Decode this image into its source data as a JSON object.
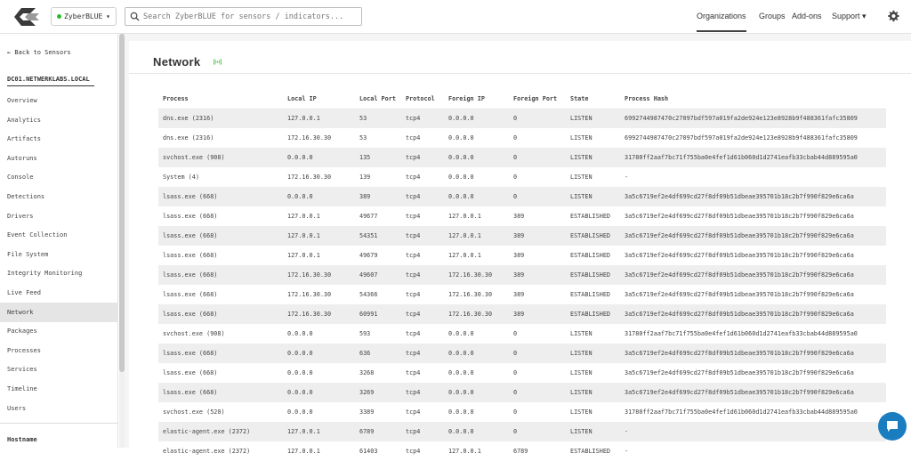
{
  "header": {
    "org": "ZyberBLUE",
    "search_placeholder": "Search ZyberBLUE for sensors / indicators...",
    "nav": [
      "Organizations",
      "Groups",
      "Add-ons",
      "Support"
    ]
  },
  "sidebar": {
    "back": "← Back to Sensors",
    "hostname": "DC01.NETWERKLABS.LOCAL",
    "items": [
      "Overview",
      "Analytics",
      "Artifacts",
      "Autoruns",
      "Console",
      "Detections",
      "Drivers",
      "Event Collection",
      "File System",
      "Integrity Monitoring",
      "Live Feed",
      "Network",
      "Packages",
      "Processes",
      "Services",
      "Timeline",
      "Users"
    ],
    "active": "Network",
    "footer_label": "Hostname"
  },
  "page": {
    "title": "Network"
  },
  "table": {
    "columns": [
      "Process",
      "Local IP",
      "Local Port",
      "Protocol",
      "Foreign IP",
      "Foreign Port",
      "State",
      "Process Hash"
    ],
    "rows": [
      [
        "dns.exe (2316)",
        "127.0.0.1",
        "53",
        "tcp4",
        "0.0.0.0",
        "0",
        "LISTEN",
        "6992744987470c27097bdf597a019fa2de924e123e8928b9f488361fafc35809"
      ],
      [
        "dns.exe (2316)",
        "172.16.30.30",
        "53",
        "tcp4",
        "0.0.0.0",
        "0",
        "LISTEN",
        "6992744987470c27097bdf597a019fa2de924e123e8928b9f488361fafc35809"
      ],
      [
        "svchost.exe (908)",
        "0.0.0.0",
        "135",
        "tcp4",
        "0.0.0.0",
        "0",
        "LISTEN",
        "31780ff2aaf7bc71f755ba0e4fef1d61b060d1d2741eafb33cbab44d889595a0"
      ],
      [
        "System (4)",
        "172.16.30.30",
        "139",
        "tcp4",
        "0.0.0.0",
        "0",
        "LISTEN",
        "-"
      ],
      [
        "lsass.exe (668)",
        "0.0.0.0",
        "389",
        "tcp4",
        "0.0.0.0",
        "0",
        "LISTEN",
        "3a5c6719ef2e4df699cd27f8df09b51dbeae395701b18c2b7f990f829e6ca6a"
      ],
      [
        "lsass.exe (668)",
        "127.0.0.1",
        "49677",
        "tcp4",
        "127.0.0.1",
        "389",
        "ESTABLISHED",
        "3a5c6719ef2e4df699cd27f8df09b51dbeae395701b18c2b7f990f829e6ca6a"
      ],
      [
        "lsass.exe (668)",
        "127.0.0.1",
        "54351",
        "tcp4",
        "127.0.0.1",
        "389",
        "ESTABLISHED",
        "3a5c6719ef2e4df699cd27f8df09b51dbeae395701b18c2b7f990f829e6ca6a"
      ],
      [
        "lsass.exe (668)",
        "127.0.0.1",
        "49679",
        "tcp4",
        "127.0.0.1",
        "389",
        "ESTABLISHED",
        "3a5c6719ef2e4df699cd27f8df09b51dbeae395701b18c2b7f990f829e6ca6a"
      ],
      [
        "lsass.exe (668)",
        "172.16.30.30",
        "49607",
        "tcp4",
        "172.16.30.30",
        "389",
        "ESTABLISHED",
        "3a5c6719ef2e4df699cd27f8df09b51dbeae395701b18c2b7f990f829e6ca6a"
      ],
      [
        "lsass.exe (668)",
        "172.16.30.30",
        "54366",
        "tcp4",
        "172.16.30.30",
        "389",
        "ESTABLISHED",
        "3a5c6719ef2e4df699cd27f8df09b51dbeae395701b18c2b7f990f829e6ca6a"
      ],
      [
        "lsass.exe (668)",
        "172.16.30.30",
        "60991",
        "tcp4",
        "172.16.30.30",
        "389",
        "ESTABLISHED",
        "3a5c6719ef2e4df699cd27f8df09b51dbeae395701b18c2b7f990f829e6ca6a"
      ],
      [
        "svchost.exe (908)",
        "0.0.0.0",
        "593",
        "tcp4",
        "0.0.0.0",
        "0",
        "LISTEN",
        "31780ff2aaf7bc71f755ba0e4fef1d61b060d1d2741eafb33cbab44d889595a0"
      ],
      [
        "lsass.exe (668)",
        "0.0.0.0",
        "636",
        "tcp4",
        "0.0.0.0",
        "0",
        "LISTEN",
        "3a5c6719ef2e4df699cd27f8df09b51dbeae395701b18c2b7f990f829e6ca6a"
      ],
      [
        "lsass.exe (668)",
        "0.0.0.0",
        "3268",
        "tcp4",
        "0.0.0.0",
        "0",
        "LISTEN",
        "3a5c6719ef2e4df699cd27f8df09b51dbeae395701b18c2b7f990f829e6ca6a"
      ],
      [
        "lsass.exe (668)",
        "0.0.0.0",
        "3269",
        "tcp4",
        "0.0.0.0",
        "0",
        "LISTEN",
        "3a5c6719ef2e4df699cd27f8df09b51dbeae395701b18c2b7f990f829e6ca6a"
      ],
      [
        "svchost.exe (520)",
        "0.0.0.0",
        "3389",
        "tcp4",
        "0.0.0.0",
        "0",
        "LISTEN",
        "31780ff2aaf7bc71f755ba0e4fef1d61b060d1d2741eafb33cbab44d889595a0"
      ],
      [
        "elastic-agent.exe (2372)",
        "127.0.0.1",
        "6789",
        "tcp4",
        "0.0.0.0",
        "0",
        "LISTEN",
        "-"
      ],
      [
        "elastic-agent.exe (2372)",
        "127.0.0.1",
        "61403",
        "tcp4",
        "127.0.0.1",
        "6789",
        "ESTABLISHED",
        "-"
      ]
    ]
  },
  "colors": {
    "accent": "#1a7dbf",
    "status_online": "#2eb82e",
    "row_stripe": "#eeeeee"
  },
  "icons": {
    "logo": "zyberblue-logo",
    "search": "search-icon",
    "settings": "gear-icon",
    "network": "wifi-signal-icon",
    "chat": "chat-icon"
  }
}
